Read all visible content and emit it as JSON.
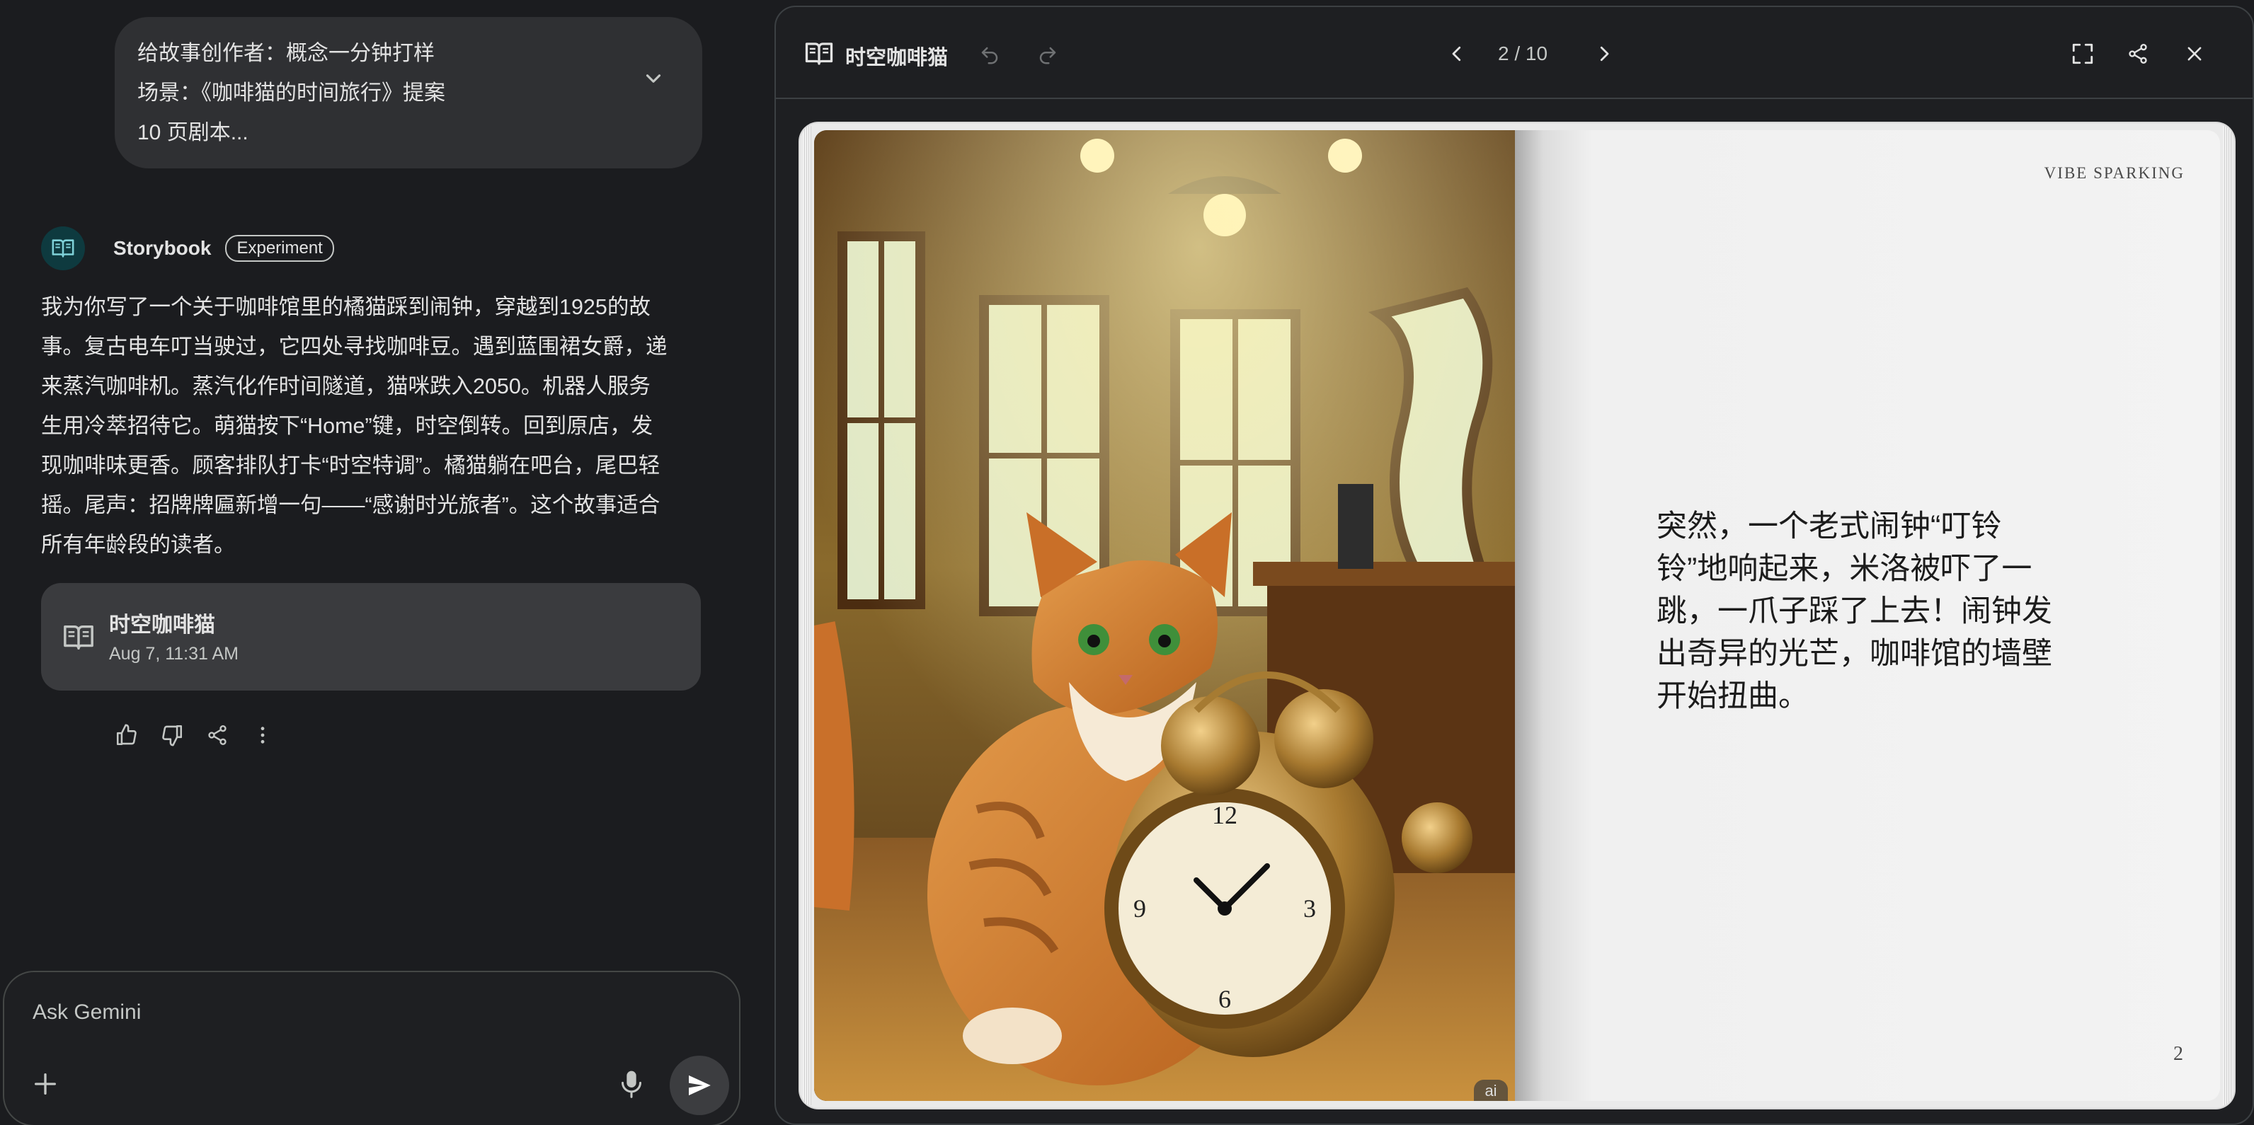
{
  "chat": {
    "user_prompt_lines": [
      "给故事创作者：概念一分钟打样",
      "场景：《咖啡猫的时间旅行》提案",
      "10 页剧本..."
    ],
    "assistant": {
      "name": "Storybook",
      "badge": "Experiment",
      "reply_lines": [
        "我为你写了一个关于咖啡馆里的橘猫踩到闹钟，穿越到1925的故",
        "事。复古电车叮当驶过，它四处寻找咖啡豆。遇到蓝围裙女爵，递",
        "来蒸汽咖啡机。蒸汽化作时间隧道，猫咪跌入2050。机器人服务",
        "生用冷萃招待它。萌猫按下“Home”键，时空倒转。回到原店，发",
        "现咖啡味更香。顾客排队打卡“时空特调”。橘猫躺在吧台，尾巴轻",
        "摇。尾声：招牌牌匾新增一句——“感谢时光旅者”。这个故事适合",
        "所有年龄段的读者。"
      ],
      "story_card": {
        "title": "时空咖啡猫",
        "date": "Aug 7, 11:31 AM"
      }
    },
    "input": {
      "placeholder": "Ask Gemini"
    }
  },
  "viewer": {
    "title": "时空咖啡猫",
    "pager": "2 / 10",
    "page": {
      "brand": "VIBE SPARKING",
      "text_lines": [
        "突然，一个老式闹钟“叮铃",
        "铃”地响起来，米洛被吓了一",
        "跳，一爪子踩了上去！闹钟发",
        "出奇异的光芒，咖啡馆的墙壁",
        "开始扭曲。"
      ],
      "page_number": "2",
      "ai_badge": "ai"
    }
  },
  "colors": {
    "background": "#1b1c1f",
    "bubble": "#2f3033",
    "card": "#3a3b3e",
    "accent_teal": "#0e3a3f"
  },
  "icons": [
    "chevron-down-icon",
    "storybook-icon",
    "thumb-up-icon",
    "thumb-down-icon",
    "share-icon",
    "more-icon",
    "plus-icon",
    "mic-icon",
    "send-icon",
    "undo-icon",
    "redo-icon",
    "prev-page-icon",
    "next-page-icon",
    "fullscreen-icon",
    "close-icon"
  ]
}
